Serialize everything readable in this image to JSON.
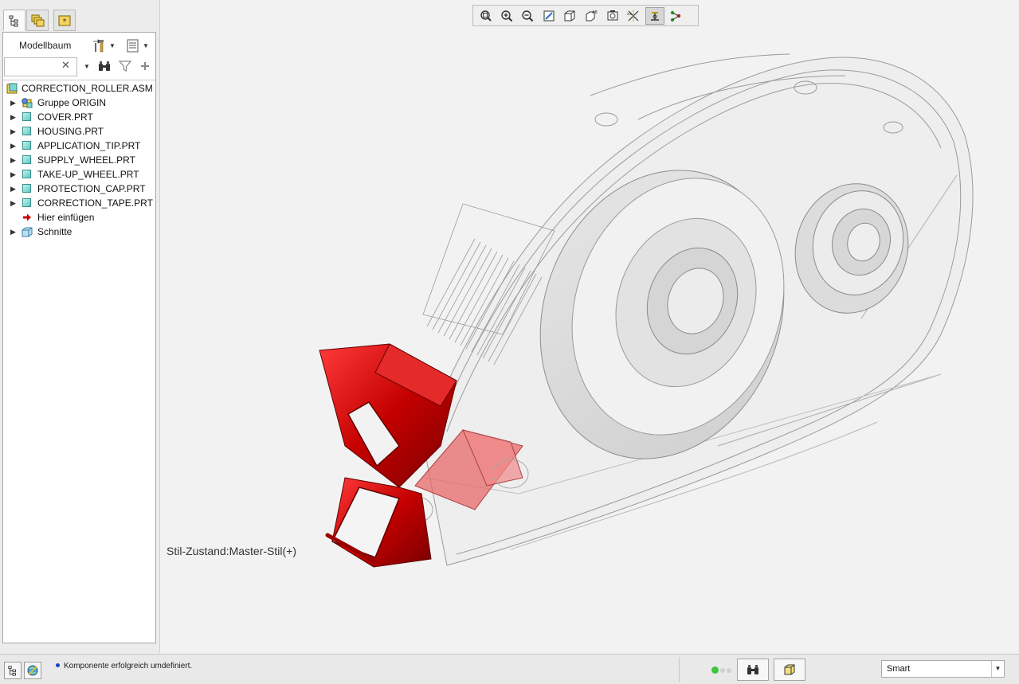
{
  "panel_tabs": [
    {
      "name": "model-tree-tab",
      "icon": "model-tree-icon",
      "active": true
    },
    {
      "name": "layers-tab",
      "icon": "layers-icon",
      "active": false
    },
    {
      "name": "favorites-tab",
      "icon": "favorites-icon",
      "active": false
    }
  ],
  "model_tree": {
    "title": "Modellbaum",
    "settings_icon": "tree-settings-icon",
    "columns_icon": "tree-columns-icon",
    "search": {
      "value": "",
      "placeholder": ""
    },
    "find_icon": "binoculars-icon",
    "filter_icon": "filter-icon",
    "add_icon": "plus-icon",
    "root": {
      "label": "CORRECTION_ROLLER.ASM",
      "icon": "assembly-icon"
    },
    "items": [
      {
        "label": "Gruppe ORIGIN",
        "icon": "group-icon",
        "expandable": true
      },
      {
        "label": "COVER.PRT",
        "icon": "part-icon",
        "expandable": true
      },
      {
        "label": "HOUSING.PRT",
        "icon": "part-icon",
        "expandable": true
      },
      {
        "label": "APPLICATION_TIP.PRT",
        "icon": "part-icon",
        "expandable": true
      },
      {
        "label": "SUPPLY_WHEEL.PRT",
        "icon": "part-icon",
        "expandable": true
      },
      {
        "label": "TAKE-UP_WHEEL.PRT",
        "icon": "part-icon",
        "expandable": true
      },
      {
        "label": "PROTECTION_CAP.PRT",
        "icon": "part-icon",
        "expandable": true
      },
      {
        "label": "CORRECTION_TAPE.PRT",
        "icon": "part-icon",
        "expandable": true
      },
      {
        "label": "Hier einfügen",
        "icon": "insert-here-arrow-icon",
        "expandable": false
      },
      {
        "label": "Schnitte",
        "icon": "sections-icon",
        "expandable": true
      }
    ]
  },
  "view_toolbar": [
    {
      "name": "refit-button",
      "icon": "refit-icon"
    },
    {
      "name": "zoom-in-button",
      "icon": "zoom-in-icon"
    },
    {
      "name": "zoom-out-button",
      "icon": "zoom-out-icon"
    },
    {
      "name": "repaint-button",
      "icon": "repaint-icon"
    },
    {
      "name": "display-style-button",
      "icon": "display-style-icon"
    },
    {
      "name": "saved-orientations-button",
      "icon": "saved-orientations-icon"
    },
    {
      "name": "view-manager-button",
      "icon": "view-manager-icon"
    },
    {
      "name": "datum-display-button",
      "icon": "datum-display-icon"
    },
    {
      "name": "annotation-display-button",
      "icon": "annotation-display-icon",
      "pressed": true
    },
    {
      "name": "spin-center-button",
      "icon": "spin-center-icon"
    }
  ],
  "viewport": {
    "style_state": "Stil-Zustand:Master-Stil(+)"
  },
  "status_bar": {
    "left_icons": [
      "model-tree-toggle-icon",
      "browser-toggle-icon"
    ],
    "message": "Komponente erfolgreich umdefiniert.",
    "regen_status_color": "#3cc63c",
    "find_icon": "binoculars-icon",
    "geometry_select_icon": "3d-box-icon",
    "selection_filter": "Smart"
  },
  "colors": {
    "accent_red": "#c40000",
    "panel_bg": "#ececec",
    "viewport_bg": "#f2f2f2"
  }
}
